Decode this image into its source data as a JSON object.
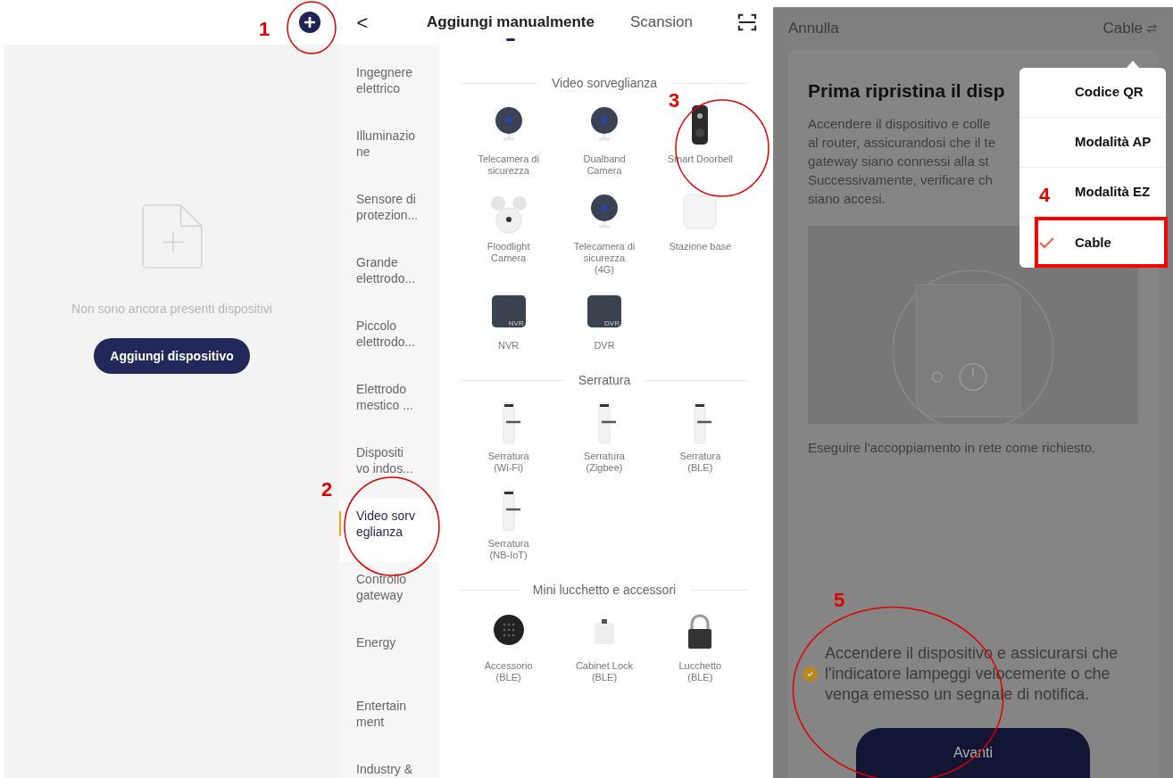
{
  "home": {
    "empty_message": "Non sono ancora presenti dispositivi",
    "add_button": "Aggiungi dispositivo"
  },
  "add_device": {
    "back": "<",
    "tabs": [
      {
        "label": "Aggiungi manualmente",
        "selected": true
      },
      {
        "label": "Scansion",
        "selected": false
      }
    ],
    "categories": [
      {
        "label": "Ingegnere\nelettrico",
        "selected": false
      },
      {
        "label": "Illuminazio\nne",
        "selected": false
      },
      {
        "label": "Sensore di\nprotezion...",
        "selected": false
      },
      {
        "label": "Grande\nelettrodo...",
        "selected": false
      },
      {
        "label": "Piccolo\nelettrodo...",
        "selected": false
      },
      {
        "label": "Elettrodo\nmestico ...",
        "selected": false
      },
      {
        "label": "Dispositi\nvo indos...",
        "selected": false
      },
      {
        "label": "Video sorv\neglianza",
        "selected": true
      },
      {
        "label": "Controllo\ngateway",
        "selected": false
      },
      {
        "label": "Energy",
        "selected": false
      },
      {
        "label": "Entertain\nment",
        "selected": false
      },
      {
        "label": "Industry &",
        "selected": false
      }
    ],
    "sections": [
      {
        "title": "Video sorveglianza",
        "devices": [
          {
            "kind": "camera",
            "label": "Telecamera di\nsicurezza"
          },
          {
            "kind": "camera",
            "label": "Dualband\nCamera"
          },
          {
            "kind": "doorbell",
            "label": "Smart Doorbell"
          },
          {
            "kind": "floodlight",
            "label": "Floodlight\nCamera"
          },
          {
            "kind": "camera",
            "label": "Telecamera di\nsicurezza\n(4G)"
          },
          {
            "kind": "base",
            "label": "Stazione base"
          },
          {
            "kind": "recorder",
            "label": "NVR",
            "box_label": "NVR"
          },
          {
            "kind": "recorder",
            "label": "DVR",
            "box_label": "DVR"
          }
        ]
      },
      {
        "title": "Serratura",
        "devices": [
          {
            "kind": "lock",
            "label": "Serratura\n(Wi-Fi)"
          },
          {
            "kind": "lock",
            "label": "Serratura\n(Zigbee)"
          },
          {
            "kind": "lock",
            "label": "Serratura\n(BLE)"
          },
          {
            "kind": "lock",
            "label": "Serratura\n(NB-IoT)"
          }
        ]
      },
      {
        "title": "Mini lucchetto e accessori",
        "devices": [
          {
            "kind": "keypad",
            "label": "Accessorio\n(BLE)"
          },
          {
            "kind": "cabinet",
            "label": "Cabinet Lock\n(BLE)"
          },
          {
            "kind": "padlock",
            "label": "Lucchetto\n(BLE)"
          }
        ]
      }
    ]
  },
  "pairing": {
    "cancel": "Annulla",
    "mode": "Cable",
    "title": "Prima ripristina il disp",
    "body_lines": [
      "Accendere il dispositivo e colle",
      "al router, assicurandosi che il te",
      "gateway siano connessi alla st",
      "Successivamente, verificare ch",
      "siano accesi."
    ],
    "help_link": "Eseguire l'accoppiamento in rete come richiesto.",
    "confirm": {
      "checked": true,
      "text": "Accendere il dispositivo e assicurarsi che l'indicatore lampeggi velocemente o che venga emesso un segnale di notifica."
    },
    "next_button": "Avanti",
    "mode_menu": [
      {
        "label": "Codice QR",
        "selected": false
      },
      {
        "label": "Modalità AP",
        "selected": false
      },
      {
        "label": "Modalità EZ",
        "selected": false
      },
      {
        "label": "Cable",
        "selected": true
      }
    ]
  },
  "annotations": [
    {
      "label": "1"
    },
    {
      "label": "2"
    },
    {
      "label": "3"
    },
    {
      "label": "4"
    },
    {
      "label": "5"
    }
  ]
}
